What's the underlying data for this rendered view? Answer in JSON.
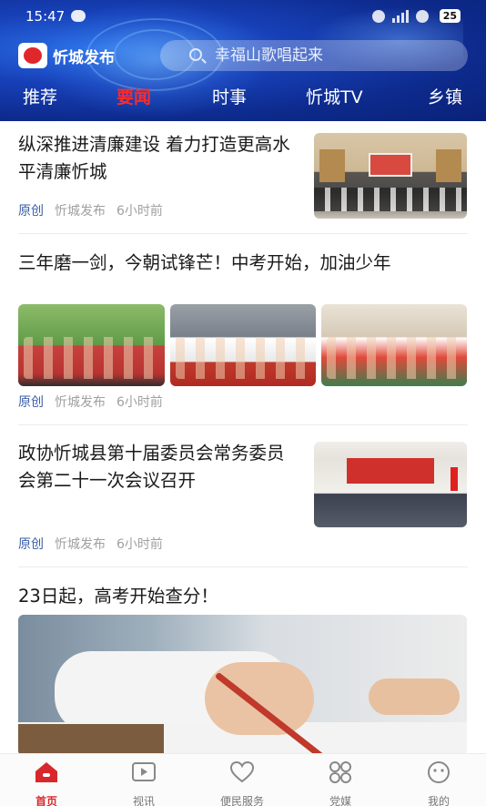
{
  "status_bar": {
    "time": "15:47",
    "battery": "25"
  },
  "header": {
    "app_name": "忻城发布",
    "search_placeholder": "幸福山歌唱起来",
    "tabs": [
      "推荐",
      "要闻",
      "时事",
      "忻城TV",
      "乡镇"
    ],
    "active_tab": "要闻"
  },
  "articles": [
    {
      "title": "纵深推进清廉建设 着力打造更高水平清廉忻城",
      "tag": "原创",
      "source": "忻城发布",
      "time": "6小时前"
    },
    {
      "title": "三年磨一剑，今朝试锋芒！中考开始，加油少年",
      "tag": "原创",
      "source": "忻城发布",
      "time": "6小时前"
    },
    {
      "title": "政协忻城县第十届委员会常务委员会第二十一次会议召开",
      "tag": "原创",
      "source": "忻城发布",
      "time": "6小时前"
    },
    {
      "title": "23日起，高考开始查分！"
    }
  ],
  "bottom_nav": {
    "items": [
      "首页",
      "视讯",
      "便民服务",
      "党媒",
      "我的"
    ],
    "active": "首页"
  },
  "colors": {
    "accent": "#d9282c",
    "header_bg": "#1740b8",
    "tag": "#3a5fa6"
  }
}
